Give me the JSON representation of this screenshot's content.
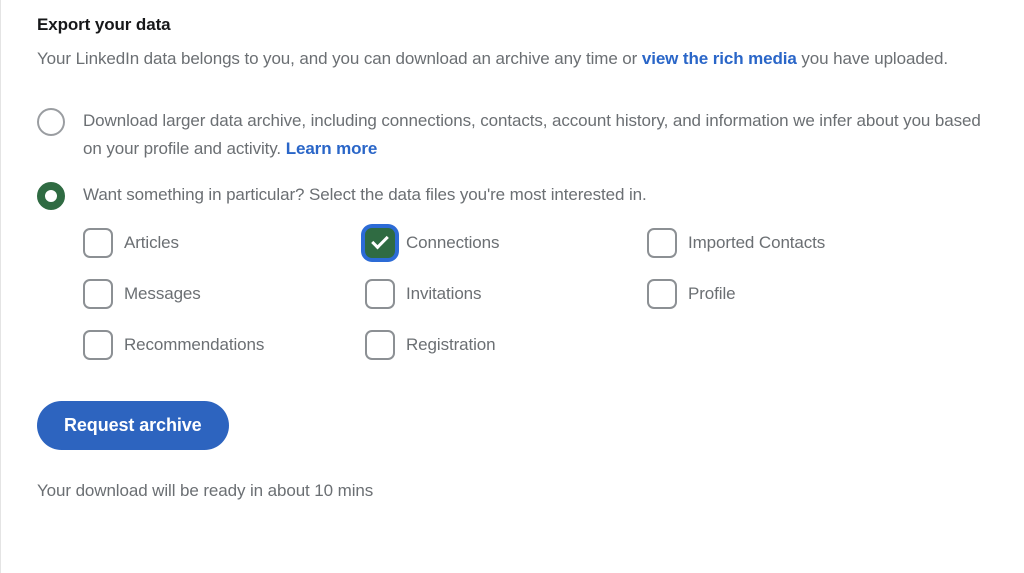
{
  "panel": {
    "title": "Export your data",
    "description_part1": "Your LinkedIn data belongs to you, and you can download an archive any time or ",
    "description_link": "view the rich media",
    "description_part2": " you have uploaded."
  },
  "options": [
    {
      "id": "larger-archive",
      "selected": false,
      "text_part1": "Download larger data archive, including connections, contacts, account history, and information we infer about you based on your profile and activity. ",
      "link": "Learn more"
    },
    {
      "id": "specific-files",
      "selected": true,
      "text_part1": "Want something in particular? Select the data files you're most interested in.",
      "link": ""
    }
  ],
  "checkboxes": [
    [
      {
        "label": "Articles",
        "checked": false
      },
      {
        "label": "Connections",
        "checked": true
      },
      {
        "label": "Imported Contacts",
        "checked": false
      }
    ],
    [
      {
        "label": "Messages",
        "checked": false
      },
      {
        "label": "Invitations",
        "checked": false
      },
      {
        "label": "Profile",
        "checked": false
      }
    ],
    [
      {
        "label": "Recommendations",
        "checked": false
      },
      {
        "label": "Registration",
        "checked": false
      }
    ]
  ],
  "actions": {
    "request_archive_label": "Request archive"
  },
  "status": {
    "download_note": "Your download will be ready in about 10 mins"
  },
  "colors": {
    "link_blue": "#2a66c8",
    "button_blue": "#2d64bf",
    "selected_green": "#2f6b42",
    "focus_ring_blue": "#2c6bd6",
    "body_text_gray": "#6b6f73",
    "title_black": "#17181a"
  }
}
